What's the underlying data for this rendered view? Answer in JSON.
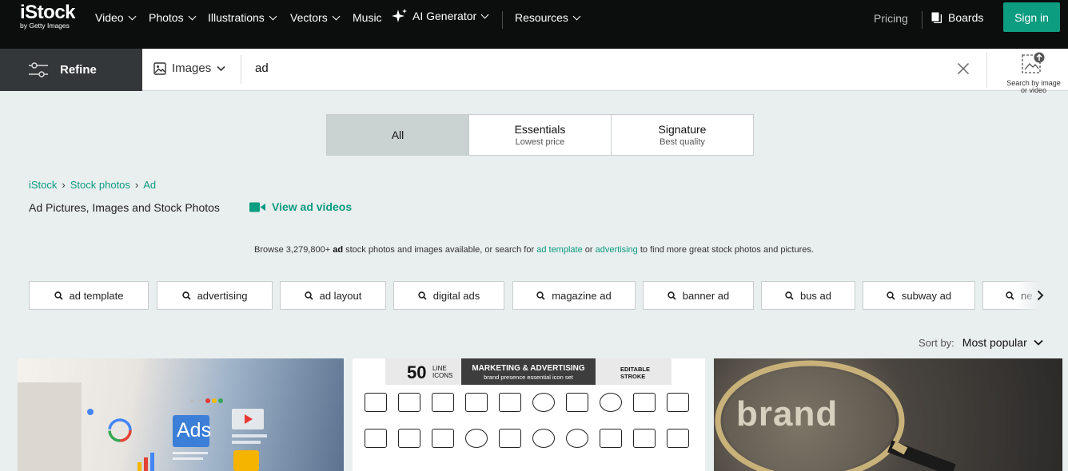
{
  "nav": {
    "logo_main": "iStock",
    "logo_sub": "by Getty Images",
    "items": [
      "Video",
      "Photos",
      "Illustrations",
      "Vectors",
      "Music",
      "AI Generator",
      "Resources"
    ],
    "pricing": "Pricing",
    "boards": "Boards",
    "sign_in": "Sign in"
  },
  "search": {
    "refine": "Refine",
    "type": "Images",
    "query": "ad",
    "image_search_label_1": "Search by image",
    "image_search_label_2": "or video"
  },
  "filter": {
    "all": "All",
    "essentials": "Essentials",
    "essentials_sub": "Lowest price",
    "signature": "Signature",
    "signature_sub": "Best quality"
  },
  "breadcrumb": [
    "iStock",
    "Stock photos",
    "Ad"
  ],
  "page": {
    "title": "Ad Pictures, Images and Stock Photos",
    "view_videos": "View ad videos",
    "browse_pre": "Browse 3,279,800+",
    "browse_term": "ad",
    "browse_mid": "stock photos and images available, or search for",
    "browse_link1": "ad template",
    "browse_or": "or",
    "browse_link2": "advertising",
    "browse_post": "to find more great stock photos and pictures."
  },
  "chips": [
    "ad template",
    "advertising",
    "ad layout",
    "digital ads",
    "magazine ad",
    "banner ad",
    "bus ad",
    "subway ad",
    "ne"
  ],
  "sort": {
    "label": "Sort by:",
    "value": "Most popular"
  },
  "thumbs": {
    "t1_ads": "Ads",
    "t2_count": "50",
    "t2_line": "LINE",
    "t2_icons": "ICONS",
    "t2_heading": "MARKETING & ADVERTISING",
    "t2_sub": "brand presence essential icon set",
    "t2_editable": "EDITABLE",
    "t2_stroke": "STROKE",
    "t3_word": "brand"
  },
  "colors": {
    "accent": "#0c9c80",
    "nav_bg": "#0c0d0d",
    "page_bg": "#e9eeee"
  }
}
